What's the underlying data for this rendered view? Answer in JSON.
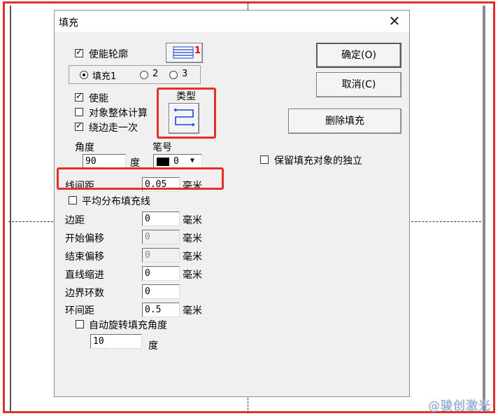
{
  "dialog": {
    "title": "填充",
    "close_glyph": "✕",
    "enable_outline": {
      "label": "使能轮廓",
      "checked": true
    },
    "outline_pattern_marker": "1",
    "fill_radio": {
      "options": [
        "填充1",
        "2",
        "3"
      ],
      "selected": "填充1"
    },
    "enable": {
      "label": "使能",
      "checked": true
    },
    "whole_object_calc": {
      "label": "对象整体计算",
      "checked": false
    },
    "around_edge_once": {
      "label": "绕边走一次",
      "checked": true
    },
    "type_label": "类型",
    "angle": {
      "label": "角度",
      "value": "90",
      "unit": "度"
    },
    "pen": {
      "label": "笔号",
      "value": "0",
      "color": "#000000"
    },
    "line_spacing": {
      "label": "线间距",
      "value": "0.05",
      "unit": "毫米"
    },
    "even_distribute": {
      "label": "平均分布填充线",
      "checked": false
    },
    "margin": {
      "label": "边距",
      "value": "0",
      "unit": "毫米"
    },
    "start_offset": {
      "label": "开始偏移",
      "value": "0",
      "unit": "毫米"
    },
    "end_offset": {
      "label": "结束偏移",
      "value": "0",
      "unit": "毫米"
    },
    "line_indent": {
      "label": "直线缩进",
      "value": "0",
      "unit": "毫米"
    },
    "border_rings": {
      "label": "边界环数",
      "value": "0"
    },
    "ring_spacing": {
      "label": "环间距",
      "value": "0.5",
      "unit": "毫米"
    },
    "auto_rotate": {
      "label": "自动旋转填充角度",
      "checked": false,
      "value": "10",
      "unit": "度"
    },
    "ok_button": {
      "label": "确定(O)"
    },
    "cancel_button": {
      "label": "取消(C)"
    },
    "delete_fill_button": {
      "label": "删除填充"
    },
    "keep_independent": {
      "label": "保留填充对象的独立",
      "checked": false
    }
  },
  "watermark": "@骏创激光",
  "colors": {
    "highlight": "#e4302b",
    "pattern_blue": "#1a3fd6",
    "marker_red": "#e00000"
  }
}
